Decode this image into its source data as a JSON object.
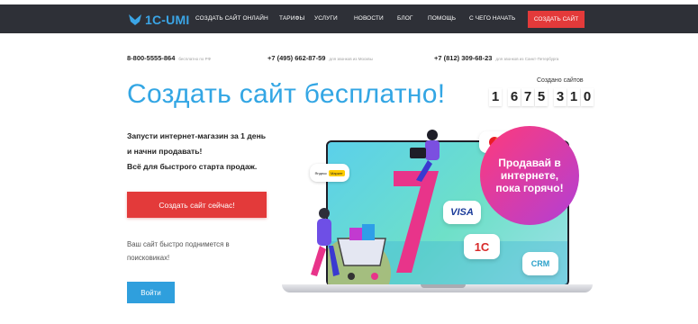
{
  "header": {
    "logo_text": "1C-UMI",
    "nav": [
      {
        "label": "СОЗДАТЬ САЙТ ОНЛАЙН"
      },
      {
        "label": "ТАРИФЫ"
      },
      {
        "label": "УСЛУГИ"
      },
      {
        "label": "НОВОСТИ"
      },
      {
        "label": "БЛОГ"
      },
      {
        "label": "ПОМОЩЬ"
      },
      {
        "label": "С ЧЕГО НАЧАТЬ"
      }
    ],
    "cta_label": "СОЗДАТЬ САЙТ"
  },
  "phones": [
    {
      "number": "8-800-5555-864",
      "note": "бесплатно по РФ"
    },
    {
      "number": "+7 (495) 662-87-59",
      "note": "для звонков из Москвы"
    },
    {
      "number": "+7 (812) 309-68-23",
      "note": "для звонков из Санкт-Петербурга"
    }
  ],
  "hero": {
    "title": "Создать сайт бесплатно!",
    "counter_label": "Создано сайтов",
    "counter_digits": [
      "1",
      "6",
      "7",
      "5",
      "3",
      "1",
      "0"
    ],
    "lead_lines": [
      "Запусти интернет-магазин за 1 день",
      "и начни продавать!",
      "Всё для быстрого старта продаж."
    ],
    "cta_label": "Создать сайт сейчас!",
    "seo_lines": [
      "Ваш сайт быстро поднимется в",
      "поисковиках!"
    ],
    "login_label": "Войти"
  },
  "illustration": {
    "badge_text": "Продавай в интернете, пока горячо!",
    "visa": "VISA",
    "crm": "CRM",
    "onec": "1С",
    "market_brand": "Яндекс",
    "market_label": "Маркет"
  },
  "colors": {
    "accent_blue": "#33a6e4",
    "cta_red": "#e33a3a",
    "topbar": "#2e3037"
  }
}
